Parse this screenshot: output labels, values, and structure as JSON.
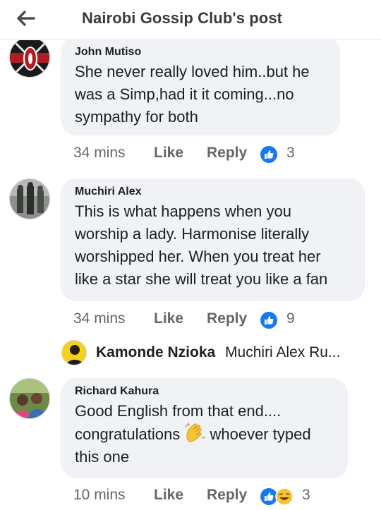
{
  "header": {
    "title": "Nairobi Gossip Club's post"
  },
  "comments": [
    {
      "author": "John Mutiso",
      "lines": [
        "She never really loved him..but he",
        "was a Simp,had it it coming...no",
        "sympathy for both"
      ],
      "time": "34 mins",
      "like_label": "Like",
      "reply_label": "Reply",
      "reaction_count": "3",
      "reaction": "like-icon"
    },
    {
      "author": "Muchiri Alex",
      "lines": [
        "This is what happens when you",
        "worship a lady. Harmonise literally",
        "worshipped her. When you treat her",
        "like a star she will treat you like a fan"
      ],
      "time": "34 mins",
      "like_label": "Like",
      "reply_label": "Reply",
      "reaction_count": "9",
      "reaction": "like-icon",
      "reply_preview": {
        "name": "Kamonde Nzioka",
        "snippet": "Muchiri Alex Ru..."
      }
    },
    {
      "author": "Richard Kahura",
      "lines": [
        "Good English from that end....",
        "congratulations",
        "whoever typed",
        "this one"
      ],
      "emoji": "clapping-hands-emoji",
      "time": "10 mins",
      "like_label": "Like",
      "reply_label": "Reply",
      "reaction_count": "3",
      "reactions": [
        "like-icon",
        "laughing-emoji"
      ]
    }
  ],
  "colors": {
    "like_blue": "#1877f2",
    "bubble": "#f0f2f5",
    "meta_grey": "#65676b"
  }
}
